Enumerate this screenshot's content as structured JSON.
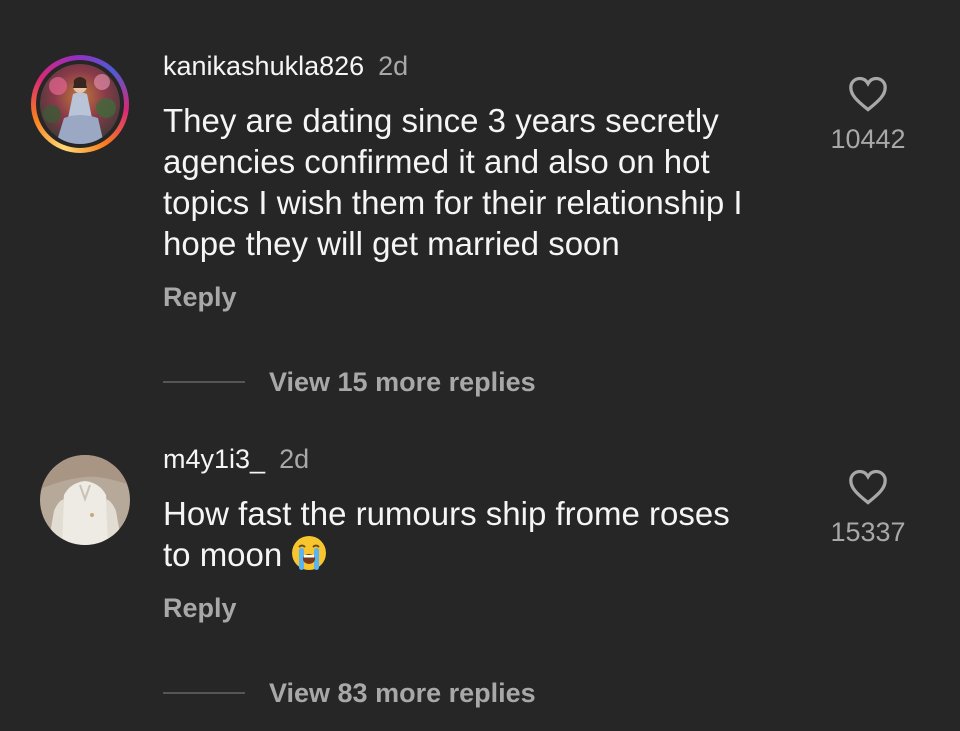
{
  "comments": [
    {
      "username": "kanikashukla826",
      "time": "2d",
      "text_lines": [
        "They are dating since 3 years secretly",
        "agencies confirmed it and also on hot",
        "topics I wish them for their relationship I",
        "hope they will get married soon"
      ],
      "reply_label": "Reply",
      "like_count": "10442",
      "view_more_label": "View 15 more replies",
      "has_story_ring": true
    },
    {
      "username": "m4y1i3_",
      "time": "2d",
      "text_lines": [
        "How fast the rumours ship frome roses",
        "to moon"
      ],
      "emoji": "loudly-crying-face",
      "reply_label": "Reply",
      "like_count": "15337",
      "view_more_label": "View 83 more replies",
      "has_story_ring": false
    }
  ],
  "colors": {
    "background": "#262626",
    "primary_text": "#f5f5f5",
    "secondary_text": "#a8a8a8"
  }
}
